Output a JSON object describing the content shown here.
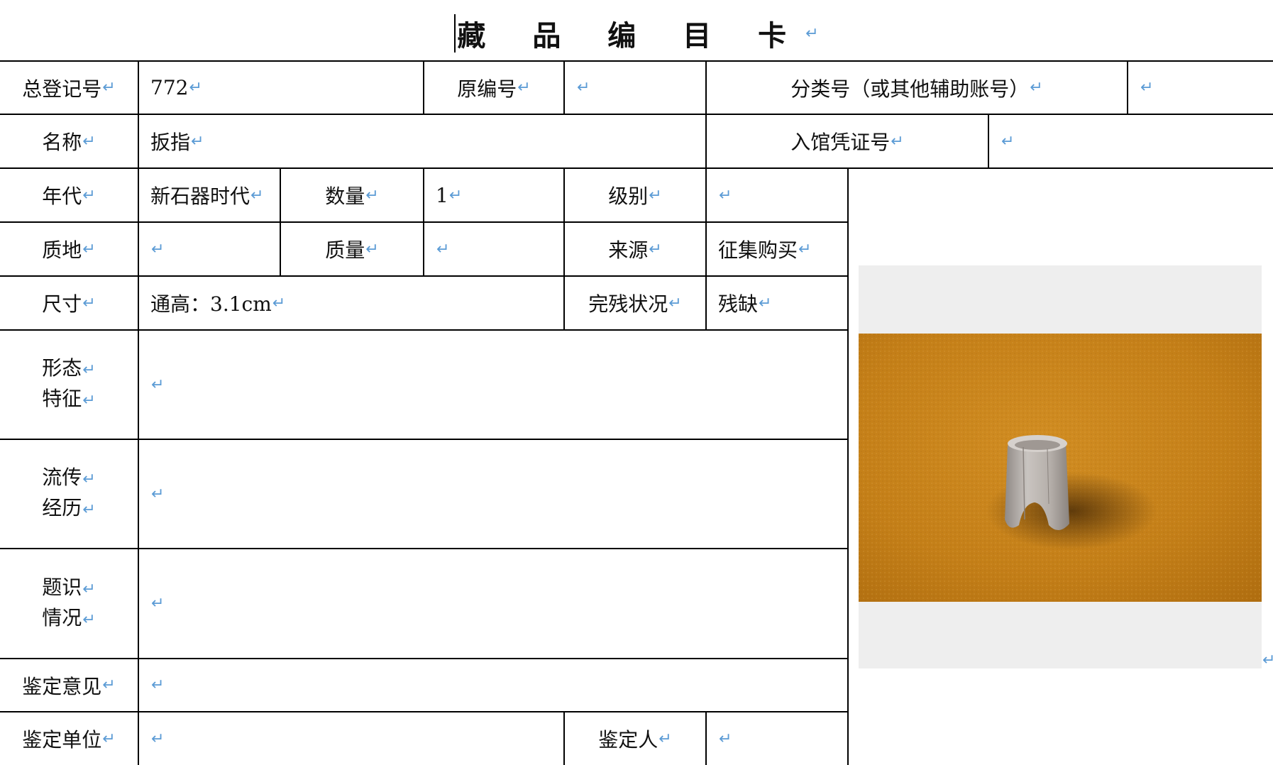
{
  "title": "藏 品 编 目 卡",
  "fields": {
    "total_reg_no": {
      "label": "总登记号",
      "value": "772"
    },
    "original_no": {
      "label": "原编号",
      "value": ""
    },
    "class_no": {
      "label": "分类号（或其他辅助账号）",
      "value": ""
    },
    "name": {
      "label": "名称",
      "value": "扳指"
    },
    "entry_voucher": {
      "label": "入馆凭证号",
      "value": ""
    },
    "era": {
      "label": "年代",
      "value": "新石器时代"
    },
    "quantity": {
      "label": "数量",
      "value": "1"
    },
    "grade": {
      "label": "级别",
      "value": ""
    },
    "material": {
      "label": "质地",
      "value": ""
    },
    "weight": {
      "label": "质量",
      "value": ""
    },
    "source": {
      "label": "来源",
      "value": "征集购买"
    },
    "size": {
      "label": "尺寸",
      "value": "通高：3.1cm"
    },
    "condition": {
      "label": "完残状况",
      "value": "残缺"
    },
    "form": {
      "label_line1": "形态",
      "label_line2": "特征",
      "value": ""
    },
    "history": {
      "label_line1": "流传",
      "label_line2": "经历",
      "value": ""
    },
    "inscription": {
      "label_line1": "题识",
      "label_line2": "情况",
      "value": ""
    },
    "appraisal_opinion": {
      "label": "鉴定意见",
      "value": ""
    },
    "appraisal_unit": {
      "label": "鉴定单位",
      "value": ""
    },
    "appraiser": {
      "label": "鉴定人",
      "value": ""
    }
  },
  "marks": {
    "paragraph": "↵"
  },
  "colors": {
    "paragraph_mark": "#5b9bd5",
    "photo_background": "#c8821c",
    "artifact": "#b9b4b0"
  }
}
